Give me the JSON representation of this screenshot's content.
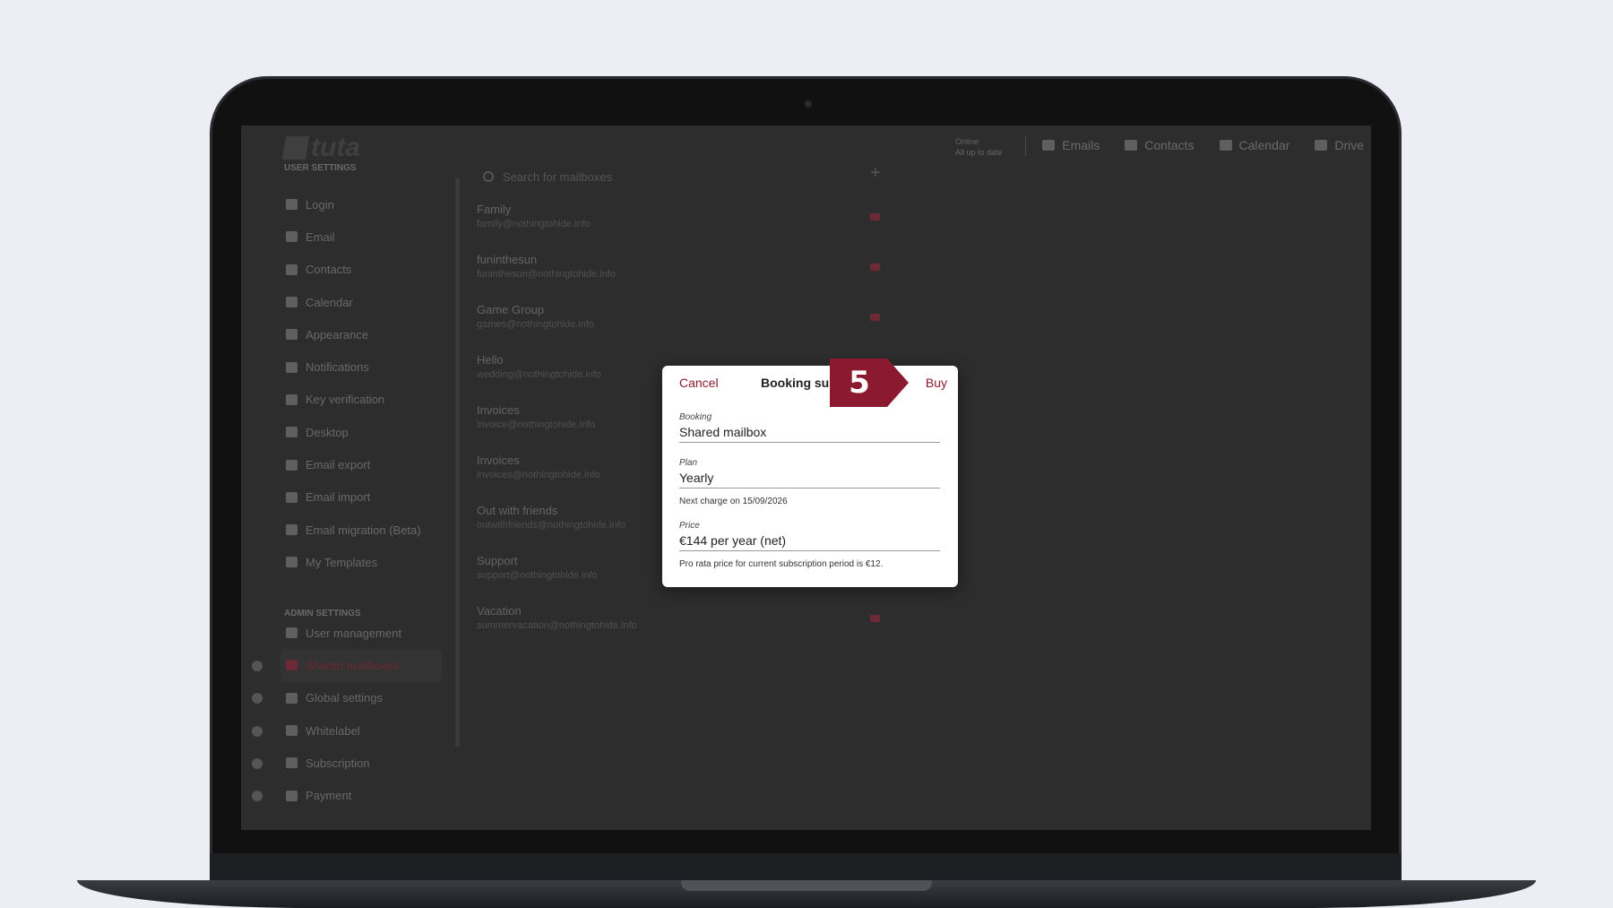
{
  "app": {
    "logo": "tuta",
    "status_line1": "Online",
    "status_line2": "All up to date"
  },
  "topnav": [
    {
      "label": "Emails",
      "icon": "mail-icon"
    },
    {
      "label": "Contacts",
      "icon": "contacts-icon"
    },
    {
      "label": "Calendar",
      "icon": "calendar-icon"
    },
    {
      "label": "Drive",
      "icon": "drive-icon"
    }
  ],
  "sidebar": {
    "user_title": "USER SETTINGS",
    "user_items": [
      "Login",
      "Email",
      "Contacts",
      "Calendar",
      "Appearance",
      "Notifications",
      "Key verification",
      "Desktop",
      "Email export",
      "Email import",
      "Email migration (Beta)",
      "My Templates"
    ],
    "admin_title": "ADMIN SETTINGS",
    "admin_items": [
      "User management",
      "Shared mailboxes",
      "Global settings",
      "Whitelabel",
      "Subscription",
      "Payment"
    ],
    "active": "Shared mailboxes"
  },
  "search": {
    "placeholder": "Search for mailboxes"
  },
  "mailboxes": [
    {
      "name": "Family",
      "address": "family@nothingtohide.info"
    },
    {
      "name": "funinthesun",
      "address": "funinthesun@nothingtohide.info"
    },
    {
      "name": "Game Group",
      "address": "games@nothingtohide.info"
    },
    {
      "name": "Hello",
      "address": "wedding@nothingtohide.info"
    },
    {
      "name": "Invoices",
      "address": "invoice@nothingtohide.info"
    },
    {
      "name": "Invoices",
      "address": "invoices@nothingtohide.info"
    },
    {
      "name": "Out with friends",
      "address": "outwithfriends@nothingtohide.info"
    },
    {
      "name": "Support",
      "address": "support@nothingtohide.info"
    },
    {
      "name": "Vacation",
      "address": "summervacation@nothingtohide.info"
    }
  ],
  "dialog": {
    "cancel": "Cancel",
    "title": "Booking sum",
    "buy": "Buy",
    "booking_label": "Booking",
    "booking_value": "Shared mailbox",
    "plan_label": "Plan",
    "plan_value": "Yearly",
    "next_charge": "Next charge on 15/09/2026",
    "price_label": "Price",
    "price_value": "€144 per year (net)",
    "pro_rata": "Pro rata price for current subscription period is €12."
  },
  "callout": {
    "step": "5",
    "color": "#8b1a30"
  }
}
